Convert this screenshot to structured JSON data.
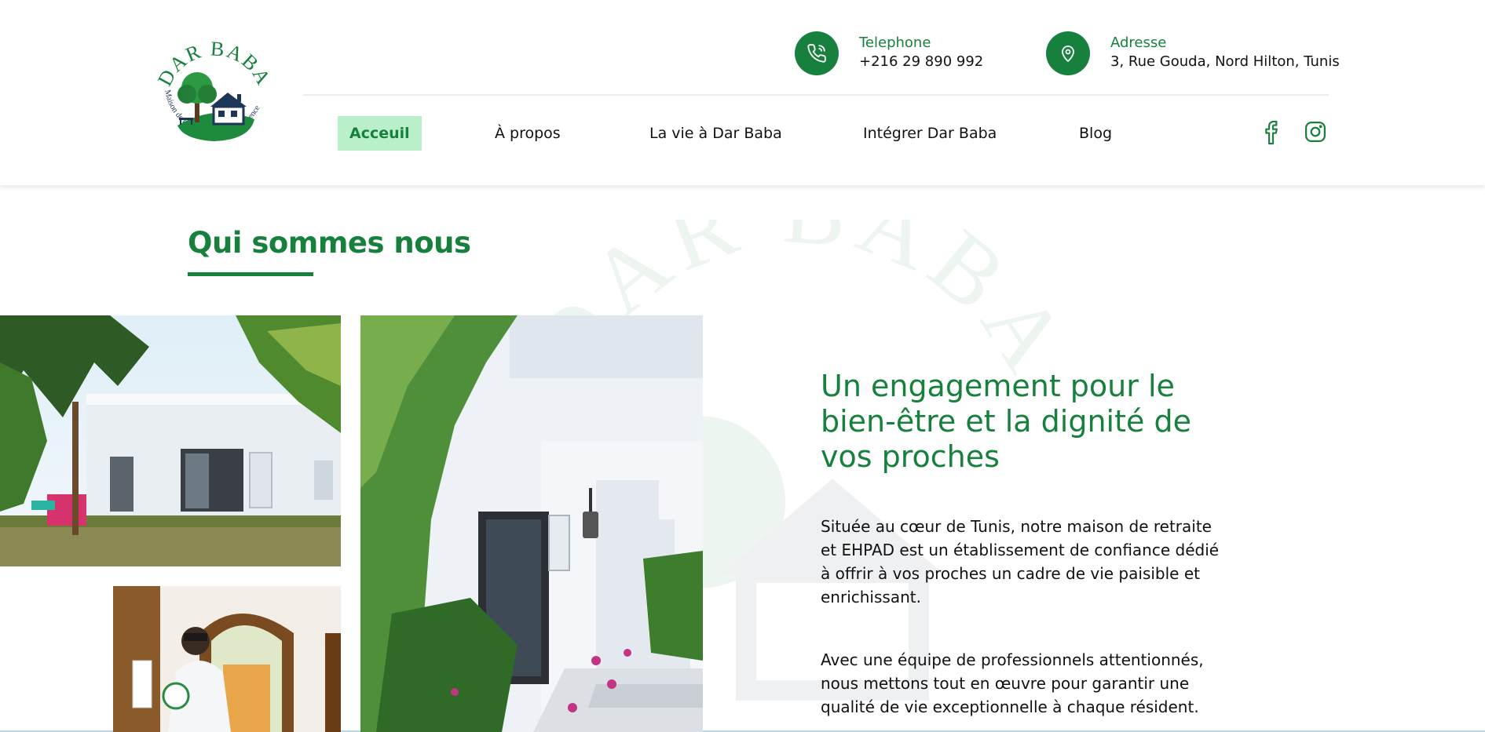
{
  "brand": {
    "logo_arc_text": "DAR BABA",
    "logo_tagline": "Maison de retraite et de convalescence",
    "primary_color": "#17803d",
    "accent_bg": "#b9f0cb"
  },
  "contact": {
    "phone": {
      "label": "Telephone",
      "value": "+216 29 890 992",
      "icon": "phone-icon"
    },
    "address": {
      "label": "Adresse",
      "value": "3, Rue Gouda, Nord Hilton, Tunis",
      "icon": "map-pin-icon"
    }
  },
  "nav": {
    "items": [
      {
        "label": "Acceuil",
        "active": true
      },
      {
        "label": "À propos",
        "active": false
      },
      {
        "label": "La vie à Dar Baba",
        "active": false
      },
      {
        "label": "Intégrer Dar Baba",
        "active": false
      },
      {
        "label": "Blog",
        "active": false
      }
    ],
    "social": [
      "facebook-icon",
      "instagram-icon"
    ]
  },
  "about": {
    "section_title": "Qui sommes nous",
    "headline": "Un engagement pour le bien-être et la dignité de vos proches",
    "paragraph1": "Située au cœur de Tunis, notre maison de retraite et EHPAD est un établissement de confiance dédié à offrir à vos proches un cadre de vie paisible et enrichissant.",
    "paragraph2": "Avec une équipe de professionnels attentionnés, nous mettons tout en œuvre pour garantir une qualité de vie exceptionnelle à chaque résident.",
    "photos": [
      "house-garden-photo",
      "entrance-photo",
      "staff-doorway-photo"
    ]
  }
}
